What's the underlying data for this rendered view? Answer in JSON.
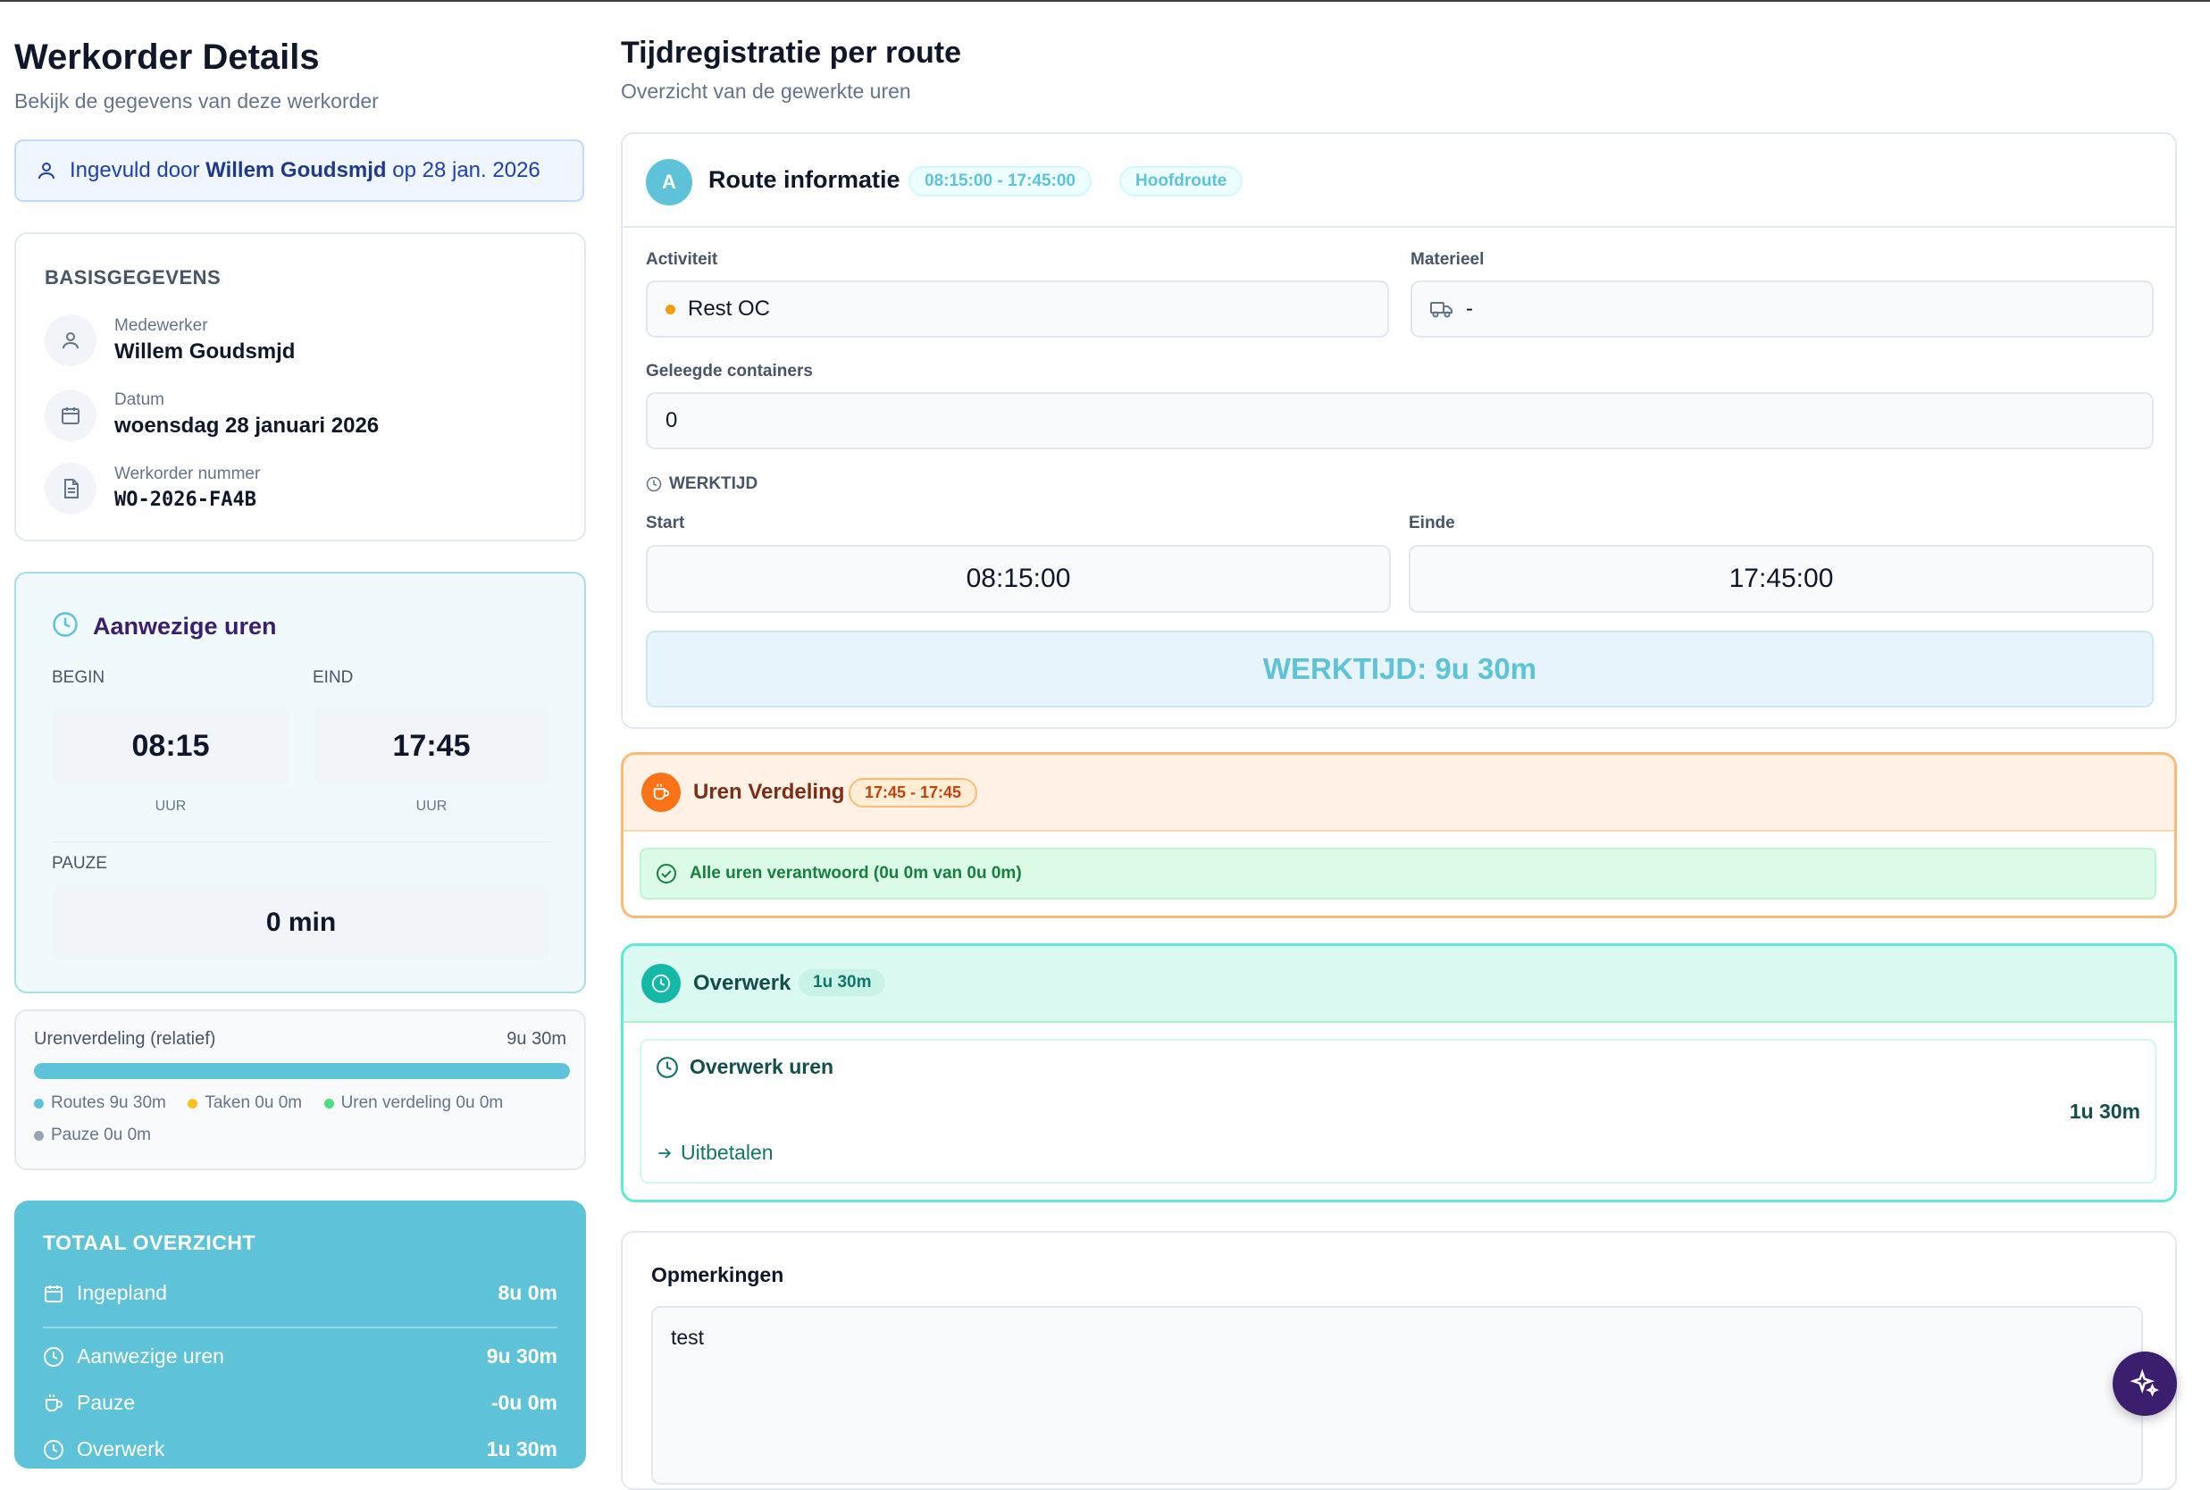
{
  "header": {
    "title": "Werkorder Details",
    "subtitle": "Bekijk de gegevens van deze werkorder"
  },
  "filled_by": {
    "prefix": "Ingevuld door",
    "name": "Willem Goudsmjd",
    "middle": "op",
    "date": "28 jan. 2026"
  },
  "basis": {
    "title": "BASISGEGEVENS",
    "fields": [
      {
        "label": "Medewerker",
        "value": "Willem Goudsmjd",
        "icon": "user-icon"
      },
      {
        "label": "Datum",
        "value": "woensdag 28 januari 2026",
        "icon": "calendar-icon"
      },
      {
        "label": "Werkorder nummer",
        "value": "WO-2026-FA4B",
        "icon": "document-icon"
      }
    ]
  },
  "attendance": {
    "title": "Aanwezige uren",
    "begin_label": "BEGIN",
    "end_label": "EIND",
    "begin": "08:15",
    "end": "17:45",
    "unit": "UUR",
    "pause_label": "PAUZE",
    "pause": "0 min"
  },
  "distribution": {
    "title": "Urenverdeling (relatief)",
    "total": "9u 30m",
    "fill_fraction": 1.0,
    "legend": [
      {
        "label": "Routes 9u 30m",
        "color": "#5ec3d9"
      },
      {
        "label": "Taken 0u 0m",
        "color": "#fbbf24"
      },
      {
        "label": "Uren verdeling 0u 0m",
        "color": "#4ade80"
      },
      {
        "label": "Pauze 0u 0m",
        "color": "#94a3b8"
      }
    ]
  },
  "totals": {
    "title": "TOTAAL OVERZICHT",
    "rows": [
      {
        "label": "Ingepland",
        "value": "8u 0m",
        "icon": "calendar-icon"
      },
      {
        "label": "Aanwezige uren",
        "value": "9u 30m",
        "icon": "clock-icon"
      },
      {
        "label": "Pauze",
        "value": "-0u 0m",
        "icon": "coffee-icon"
      },
      {
        "label": "Overwerk",
        "value": "1u 30m",
        "icon": "clock-icon"
      }
    ]
  },
  "right": {
    "title": "Tijdregistratie per route",
    "subtitle": "Overzicht van de gewerkte uren"
  },
  "route": {
    "avatar": "A",
    "title": "Route informatie",
    "time_pill": "08:15:00 - 17:45:00",
    "type_pill": "Hoofdroute",
    "activity_label": "Activiteit",
    "activity_value": "Rest OC",
    "material_label": "Materieel",
    "material_value": "-",
    "containers_label": "Geleegde containers",
    "containers_value": "0",
    "worktime_label": "WERKTIJD",
    "start_label": "Start",
    "end_label": "Einde",
    "start": "08:15:00",
    "end": "17:45:00",
    "worktime_total": "WERKTIJD: 9u 30m"
  },
  "uren_verdeling": {
    "title": "Uren Verdeling",
    "pill": "17:45 - 17:45",
    "status": "Alle uren verantwoord (0u 0m van 0u 0m)"
  },
  "overwerk": {
    "title": "Overwerk",
    "pill": "1u 30m",
    "inner_title": "Overwerk uren",
    "value": "1u 30m",
    "action": "Uitbetalen"
  },
  "remarks": {
    "title": "Opmerkingen",
    "text": "test"
  },
  "colors": {
    "accent": "#5ec3d9",
    "orange": "#f97316",
    "teal": "#14b8a6",
    "fab": "#3b1e6e"
  }
}
